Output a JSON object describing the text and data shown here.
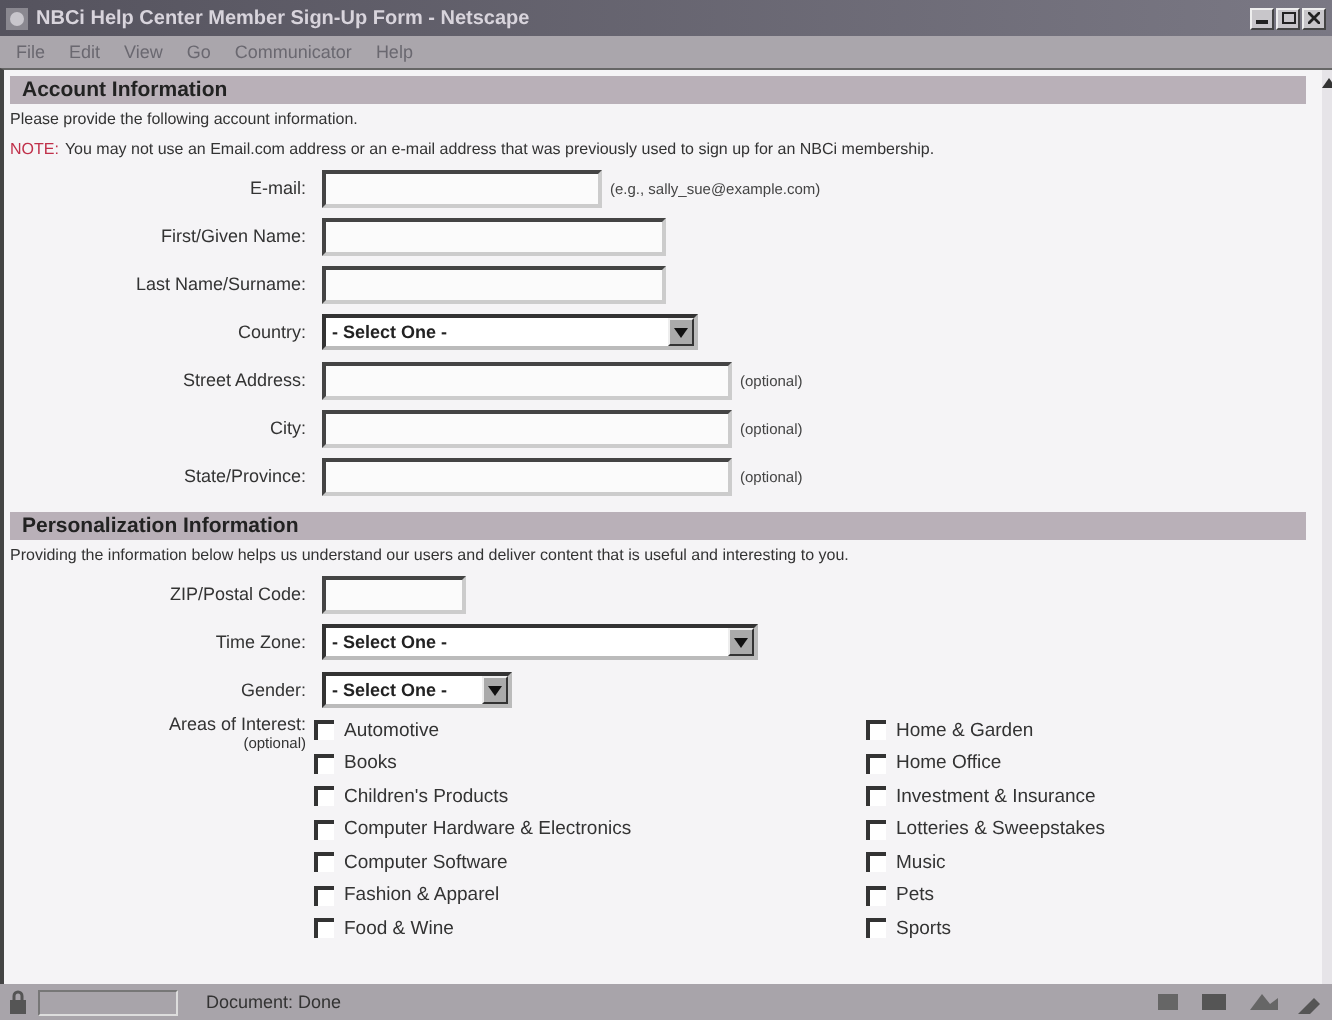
{
  "window": {
    "title": "NBCi Help Center Member Sign-Up Form - Netscape"
  },
  "menu_bar": [
    "File",
    "Edit",
    "View",
    "Go",
    "Communicator",
    "Help"
  ],
  "sections": [
    {
      "title": "Account Information",
      "intro": "Please provide the following account information.",
      "note": {
        "label": "NOTE:",
        "text": "You may not use an Email.com address or an e-mail address that was previously used to sign up for an NBCi membership."
      },
      "fields": [
        {
          "label": "E-mail:",
          "kind": "text",
          "hint": "(e.g., sally_sue@example.com)"
        },
        {
          "label": "First/Given Name:",
          "kind": "text"
        },
        {
          "label": "Last Name/Surname:",
          "kind": "text"
        },
        {
          "label": "Country:",
          "kind": "select",
          "value": "- Select One -"
        },
        {
          "label": "Street Address:",
          "kind": "text",
          "hint": "(optional)"
        },
        {
          "label": "City:",
          "kind": "text",
          "hint": "(optional)"
        },
        {
          "label": "State/Province:",
          "kind": "text",
          "hint": "(optional)"
        }
      ]
    },
    {
      "title": "Personalization Information",
      "intro": "Providing the information below helps us understand our users and deliver content that is useful and interesting to you.",
      "fields": [
        {
          "label": "ZIP/Postal Code:",
          "kind": "text"
        },
        {
          "label": "Time Zone:",
          "kind": "select",
          "value": "- Select One -"
        },
        {
          "label": "Gender:",
          "kind": "select",
          "value": "- Select One -"
        }
      ],
      "interests": {
        "label": "Areas of Interest:",
        "sublabel": "(optional)",
        "columns": [
          [
            {
              "label": "Automotive",
              "checked": false
            },
            {
              "label": "Books",
              "checked": false
            },
            {
              "label": "Children's Products",
              "checked": false
            },
            {
              "label": "Computer Hardware & Electronics",
              "checked": false
            },
            {
              "label": "Computer Software",
              "checked": false
            },
            {
              "label": "Fashion & Apparel",
              "checked": false
            },
            {
              "label": "Food & Wine",
              "checked": false
            }
          ],
          [
            {
              "label": "Home & Garden",
              "checked": false
            },
            {
              "label": "Home Office",
              "checked": false
            },
            {
              "label": "Investment & Insurance",
              "checked": false
            },
            {
              "label": "Lotteries & Sweepstakes",
              "checked": false
            },
            {
              "label": "Music",
              "checked": false
            },
            {
              "label": "Pets",
              "checked": false
            },
            {
              "label": "Sports",
              "checked": false
            }
          ]
        ]
      }
    }
  ],
  "status_bar": {
    "text": "Document: Done"
  }
}
